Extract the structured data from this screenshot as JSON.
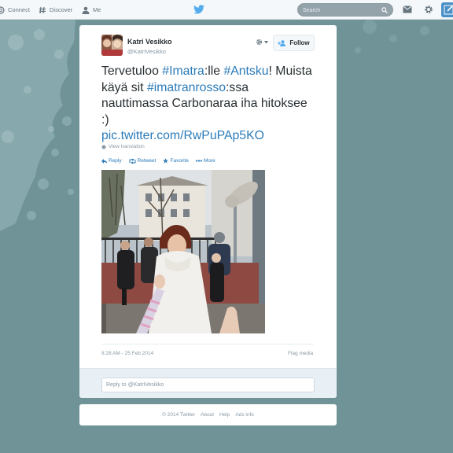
{
  "nav": {
    "connect": "Connect",
    "discover": "Discover",
    "me": "Me",
    "search_placeholder": "Search"
  },
  "tweet": {
    "name": "Katri Vesikko",
    "handle": "@KatriVesikko",
    "follow_label": "Follow",
    "text": {
      "t1": "Tervetuloo ",
      "h1": "#Imatra",
      "t2": ":lle ",
      "h2": "#Antsku",
      "t3": "! Muista käyä sit ",
      "h3": "#imatranrosso",
      "t4": ":ssa nauttimassa Carbonaraa iha hitoksee :)",
      "url": "pic.twitter.com/RwPuPAp5KO"
    },
    "view_translation": "View translation",
    "actions": {
      "reply": "Reply",
      "retweet": "Retweet",
      "favorite": "Favorite",
      "more": "More"
    },
    "timestamp": "8:28 AM - 25 Feb 2014",
    "flag_media": "Flag media",
    "reply_placeholder": "Reply to @KatriVesikko"
  },
  "footer": {
    "copyright": "© 2014 Twitter",
    "about": "About",
    "help": "Help",
    "ads": "Ads info"
  },
  "colors": {
    "background": "#6f9397",
    "link": "#2b7bb9",
    "twitter_blue": "#55acee"
  }
}
